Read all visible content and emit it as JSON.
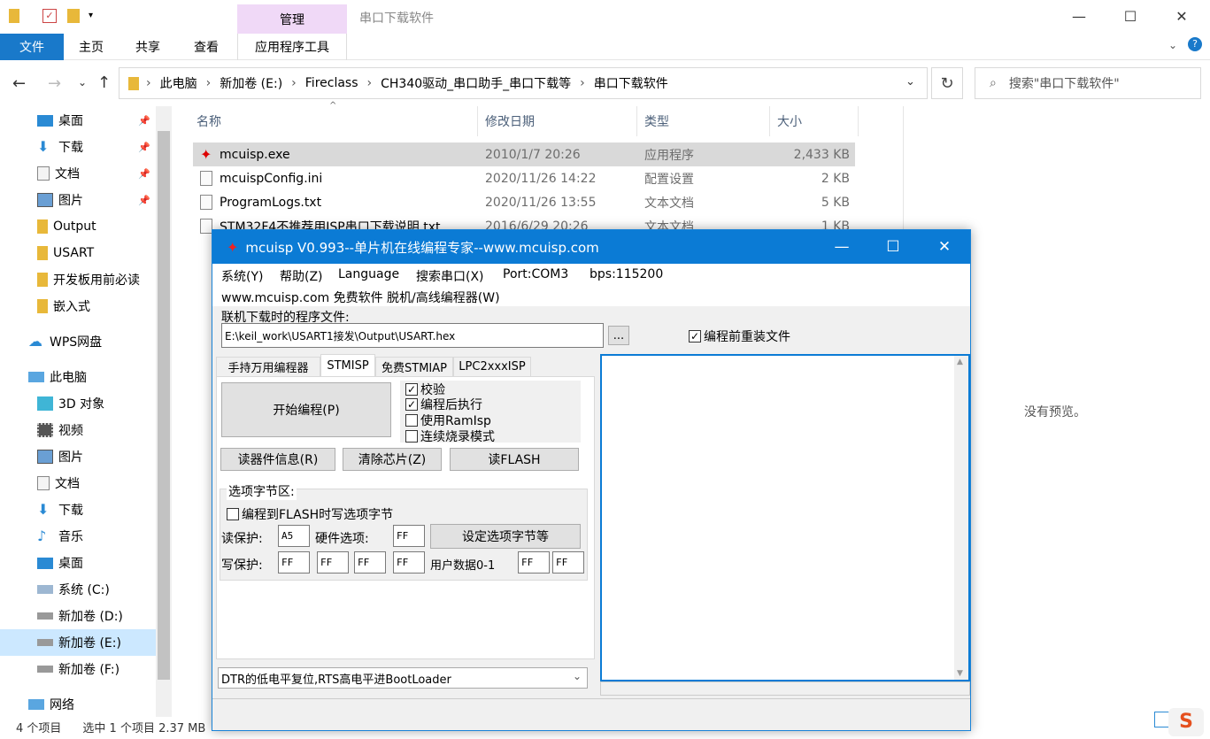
{
  "explorer": {
    "context_tab": "管理",
    "title": "串口下载软件",
    "ribbon_tabs": [
      "文件",
      "主页",
      "共享",
      "查看",
      "应用程序工具"
    ],
    "breadcrumb": [
      "此电脑",
      "新加卷 (E:)",
      "Fireclass",
      "CH340驱动_串口助手_串口下载等",
      "串口下载软件"
    ],
    "search_placeholder": "搜索\"串口下载软件\"",
    "columns": [
      "名称",
      "修改日期",
      "类型",
      "大小"
    ],
    "files": [
      {
        "name": "mcuisp.exe",
        "date": "2010/1/7 20:26",
        "type": "应用程序",
        "size": "2,433 KB"
      },
      {
        "name": "mcuispConfig.ini",
        "date": "2020/11/26 14:22",
        "type": "配置设置",
        "size": "2 KB"
      },
      {
        "name": "ProgramLogs.txt",
        "date": "2020/11/26 13:55",
        "type": "文本文档",
        "size": "5 KB"
      },
      {
        "name": "STM32F4不推荐用ISP串口下载说明.txt",
        "date": "2016/6/29 20:26",
        "type": "文本文档",
        "size": "1 KB"
      }
    ],
    "nav": [
      "桌面",
      "下载",
      "文档",
      "图片",
      "Output",
      "USART",
      "开发板用前必读",
      "嵌入式",
      "WPS网盘",
      "此电脑",
      "3D 对象",
      "视频",
      "图片",
      "文档",
      "下载",
      "音乐",
      "桌面",
      "系统 (C:)",
      "新加卷 (D:)",
      "新加卷 (E:)",
      "新加卷 (F:)",
      "网络"
    ],
    "preview_empty": "没有预览。",
    "status_count": "4 个项目",
    "status_selected": "选中 1 个项目  2.37 MB"
  },
  "mcuisp": {
    "title": "mcuisp V0.993--单片机在线编程专家--www.mcuisp.com",
    "menu": [
      "系统(Y)",
      "帮助(Z)",
      "Language",
      "搜索串口(X)",
      "Port:COM3",
      "bps:115200"
    ],
    "menu2": "www.mcuisp.com 免费软件 脱机/高线编程器(W)",
    "file_label": "联机下载时的程序文件:",
    "file_path": "E:\\keil_work\\USART1接发\\Output\\USART.hex",
    "browse": "...",
    "reload_label": "编程前重装文件",
    "tabs": [
      "手持万用编程器",
      "STMISP",
      "免费STMIAP",
      "LPC2xxxISP"
    ],
    "start_btn": "开始编程(P)",
    "checks": [
      "校验",
      "编程后执行",
      "使用RamIsp",
      "连续烧录模式"
    ],
    "read_info_btn": "读器件信息(R)",
    "erase_btn": "清除芯片(Z)",
    "read_flash_btn": "读FLASH",
    "option_group": "选项字节区:",
    "option_write_label": "编程到FLASH时写选项字节",
    "read_protect_label": "读保护:",
    "read_protect_val": "A5",
    "hw_option_label": "硬件选项:",
    "hw_option_val": "FF",
    "set_option_btn": "设定选项字节等",
    "write_protect_label": "写保护:",
    "write_protect_vals": [
      "FF",
      "FF",
      "FF",
      "FF"
    ],
    "user_data_label": "用户数据0-1",
    "user_data_vals": [
      "FF",
      "FF"
    ],
    "boot_mode": "DTR的低电平复位,RTS高电平进BootLoader"
  }
}
